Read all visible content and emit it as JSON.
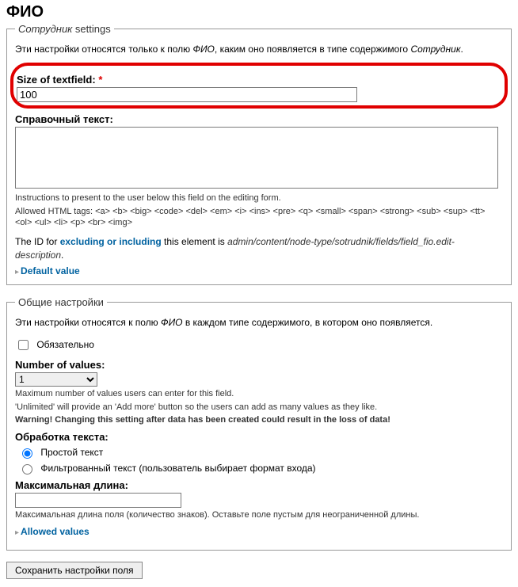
{
  "page_title": "ФИО",
  "fs1": {
    "legend_prefix_italic": "Сотрудник",
    "legend_rest": " settings",
    "desc_before": "Эти настройки относятся только к полю ",
    "desc_field_italic": "ФИО",
    "desc_mid": ", каким оно появляется в типе содержимого ",
    "desc_type_italic": "Сотрудник",
    "desc_end": ".",
    "size_label": "Size of textfield:",
    "size_value": "100",
    "help_label": "Справочный текст:",
    "help_value": "",
    "instr_line": "Instructions to present to the user below this field on the editing form.",
    "allowed_tags": "Allowed HTML tags: <a> <b> <big> <code> <del> <em> <i> <ins> <pre> <q> <small> <span> <strong> <sub> <sup> <tt> <ol> <ul> <li> <p> <br> <img>",
    "id_before": "The ID for ",
    "id_link": "excluding or including",
    "id_mid": " this element is ",
    "id_path": "admin/content/node-type/sotrudnik/fields/field_fio.edit-description",
    "id_end": ".",
    "default_value": "Default value"
  },
  "fs2": {
    "legend": "Общие настройки",
    "desc_before": "Эти настройки относятся к полю ",
    "desc_field_italic": "ФИО",
    "desc_after": " в каждом типе содержимого, в котором оно появляется.",
    "required_label": "Обязательно",
    "required_checked": false,
    "numvals_label": "Number of values:",
    "numvals_value": "1",
    "numvals_desc1": "Maximum number of values users can enter for this field.",
    "numvals_desc2": "'Unlimited' will provide an 'Add more' button so the users can add as many values as they like.",
    "numvals_warning": "Warning! Changing this setting after data has been created could result in the loss of data!",
    "textproc_label": "Обработка текста:",
    "radio_plain": "Простой текст",
    "radio_filtered": "Фильтрованный текст (пользователь выбирает формат входа)",
    "maxlen_label": "Максимальная длина:",
    "maxlen_value": "",
    "maxlen_desc": "Максимальная длина поля (количество знаков). Оставьте поле пустым для неограниченной длины.",
    "allowed_values": "Allowed values"
  },
  "submit_label": "Сохранить настройки поля"
}
